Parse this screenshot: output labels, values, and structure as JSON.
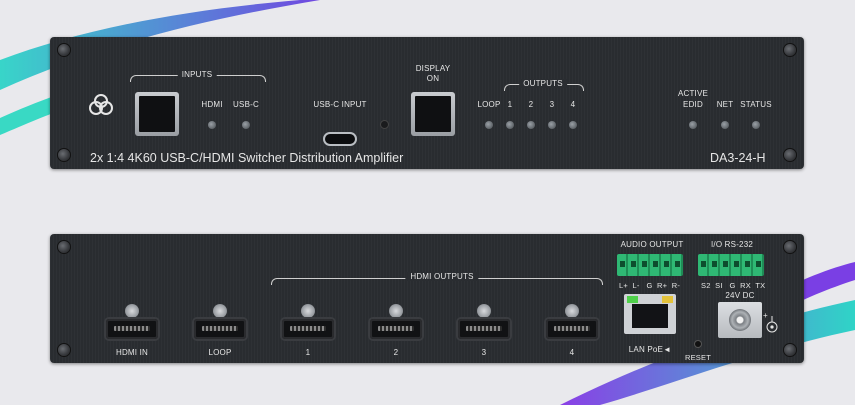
{
  "front": {
    "inputs_label": "INPUTS",
    "hdmi_label": "HDMI",
    "usbc_label": "USB-C",
    "usbc_input_label": "USB-C INPUT",
    "display_label_1": "DISPLAY",
    "display_label_2": "ON",
    "outputs_label": "OUTPUTS",
    "loop_label": "LOOP",
    "output_numbers": [
      "1",
      "2",
      "3",
      "4"
    ],
    "active_label_1": "ACTIVE",
    "active_label_2": "EDID",
    "net_label": "NET",
    "status_label": "STATUS",
    "product_name": "2x 1:4 4K60 USB-C/HDMI Switcher Distribution Amplifier",
    "model": "DA3-24-H"
  },
  "rear": {
    "hdmi_outputs_label": "HDMI OUTPUTS",
    "hdmi_in_label": "HDMI IN",
    "loop_label": "LOOP",
    "output_numbers": [
      "1",
      "2",
      "3",
      "4"
    ],
    "audio_output_label": "AUDIO OUTPUT",
    "audio_pins": "L+  L-   G  R+  R-",
    "io_label": "I/O RS-232",
    "io_pins": "S2  SI   G  RX  TX",
    "power_label": "24V DC",
    "lan_label": "LAN PoE◄",
    "reset_label": "RESET"
  },
  "colors": {
    "panel": "#2a2d31",
    "terminal_green": "#2aa86a",
    "accent_cyan": "#37d3c0",
    "accent_purple": "#7b3fe0"
  }
}
